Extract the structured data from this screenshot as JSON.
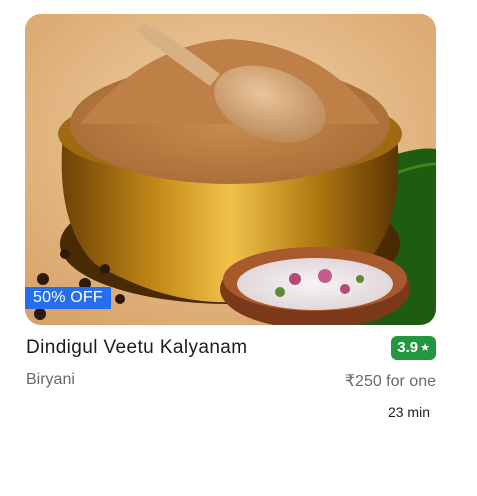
{
  "restaurant": {
    "name": "Dindigul Veetu Kalyanam",
    "rating": "3.9",
    "cuisine": "Biryani",
    "price": "₹250 for one",
    "delivery_time": "23 min",
    "offer": "50% OFF"
  },
  "icons": {
    "rating": "star-icon"
  },
  "colors": {
    "offer_bg": "#256fef",
    "rating_bg": "#24963f"
  }
}
